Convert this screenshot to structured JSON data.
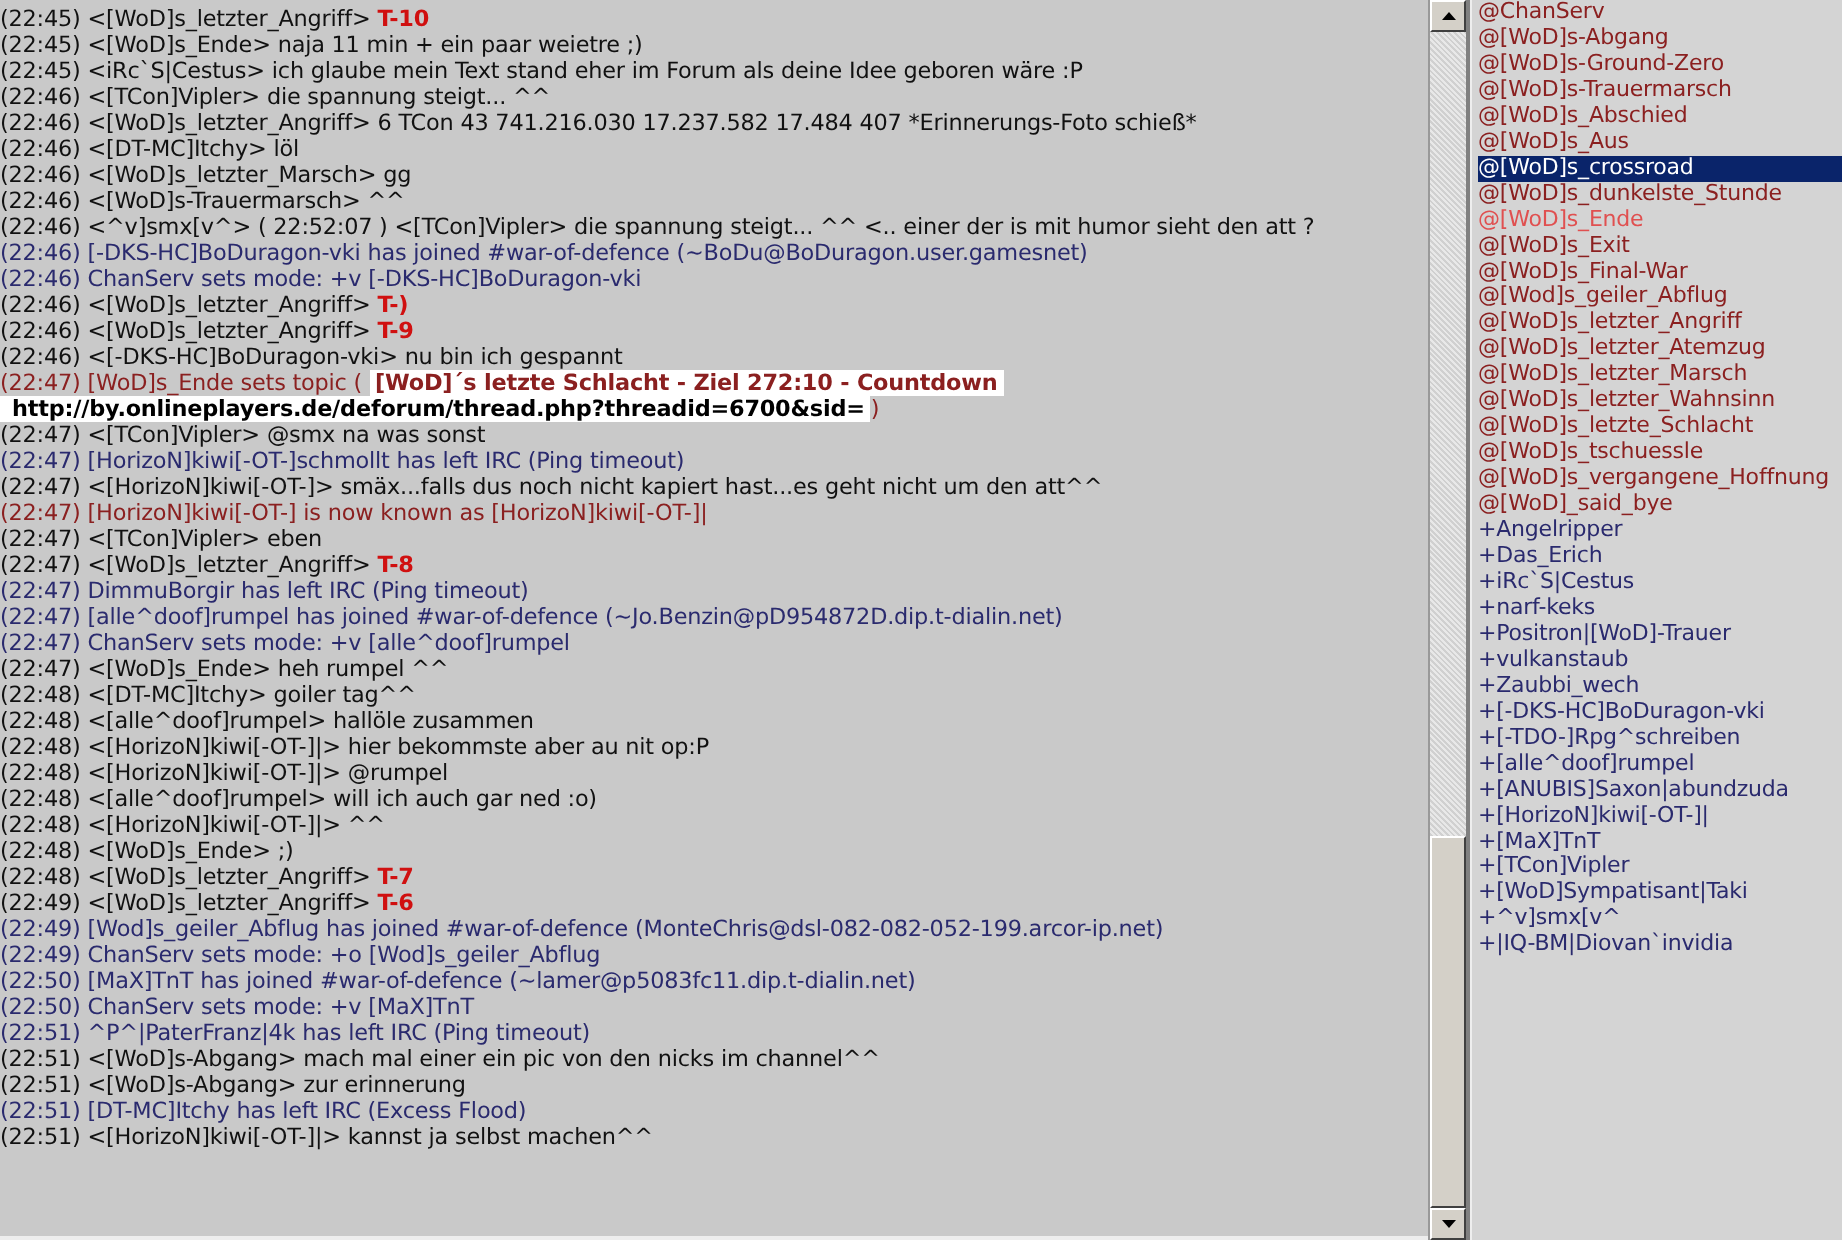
{
  "chat": [
    {
      "time": "(22:45)",
      "kind": "countdown",
      "nick": "<[WoD]s_letzter_Angriff>",
      "text": "T-10"
    },
    {
      "time": "(22:45)",
      "kind": "message",
      "nick": "<[WoD]s_Ende>",
      "text": "naja 11 min + ein paar weietre ;)"
    },
    {
      "time": "(22:45)",
      "kind": "message",
      "nick": "<iRc`S|Cestus>",
      "text": "ich glaube mein Text stand eher im Forum als deine Idee geboren wäre :P"
    },
    {
      "time": "(22:46)",
      "kind": "message",
      "nick": "<[TCon]Vipler>",
      "text": "die spannung steigt... ^^"
    },
    {
      "time": "(22:46)",
      "kind": "message",
      "nick": "<[WoD]s_letzter_Angriff>",
      "text": "6 TCon 43 741.216.030 17.237.582 17.484 407 *Erinnerungs-Foto schieß*"
    },
    {
      "time": "(22:46)",
      "kind": "message",
      "nick": "<[DT-MC]Itchy>",
      "text": "löl"
    },
    {
      "time": "(22:46)",
      "kind": "message",
      "nick": "<[WoD]s_letzter_Marsch>",
      "text": "gg"
    },
    {
      "time": "(22:46)",
      "kind": "message",
      "nick": "<[WoD]s-Trauermarsch>",
      "text": "^^"
    },
    {
      "time": "(22:46)",
      "kind": "message",
      "nick": "<^v]smx[v^>",
      "text": "( 22:52:07 ) <[TCon]Vipler> die spannung steigt... ^^ <.. einer der is mit humor sieht den att ?"
    },
    {
      "time": "(22:46)",
      "kind": "event",
      "text": "[-DKS-HC]BoDuragon-vki has joined #war-of-defence (~BoDu@BoDuragon.user.gamesnet)"
    },
    {
      "time": "(22:46)",
      "kind": "event",
      "text": "ChanServ sets mode: +v [-DKS-HC]BoDuragon-vki"
    },
    {
      "time": "(22:46)",
      "kind": "countdown",
      "nick": "<[WoD]s_letzter_Angriff>",
      "text": "T-)"
    },
    {
      "time": "(22:46)",
      "kind": "countdown",
      "nick": "<[WoD]s_letzter_Angriff>",
      "text": "T-9"
    },
    {
      "time": "(22:46)",
      "kind": "message",
      "nick": "<[-DKS-HC]BoDuragon-vki>",
      "text": "nu bin ich gespannt"
    },
    {
      "time": "(22:47)",
      "kind": "topic",
      "text": "[WoD]s_Ende sets topic (",
      "topic": "[WoD]´s letzte Schlacht - Ziel 272:10 - Countdown",
      "url": "http://by.onlineplayers.de/deforum/thread.php?threadid=6700&sid=",
      "suffix": ")"
    },
    {
      "time": "(22:47)",
      "kind": "message",
      "nick": "<[TCon]Vipler>",
      "text": "@smx na was sonst"
    },
    {
      "time": "(22:47)",
      "kind": "event",
      "text": "[HorizoN]kiwi[-OT-]schmollt has left IRC (Ping timeout)"
    },
    {
      "time": "(22:47)",
      "kind": "message",
      "nick": "<[HorizoN]kiwi[-OT-]>",
      "text": "smäx...falls dus noch nicht kapiert hast...es geht nicht um den att^^"
    },
    {
      "time": "(22:47)",
      "kind": "notice",
      "text": "[HorizoN]kiwi[-OT-] is now known as [HorizoN]kiwi[-OT-]|"
    },
    {
      "time": "(22:47)",
      "kind": "message",
      "nick": "<[TCon]Vipler>",
      "text": "eben"
    },
    {
      "time": "(22:47)",
      "kind": "countdown",
      "nick": "<[WoD]s_letzter_Angriff>",
      "text": "T-8"
    },
    {
      "time": "(22:47)",
      "kind": "event",
      "text": "DimmuBorgir has left IRC (Ping timeout)"
    },
    {
      "time": "(22:47)",
      "kind": "event",
      "text": "[alle^doof]rumpel has joined #war-of-defence (~Jo.Benzin@pD954872D.dip.t-dialin.net)"
    },
    {
      "time": "(22:47)",
      "kind": "event",
      "text": "ChanServ sets mode: +v [alle^doof]rumpel"
    },
    {
      "time": "(22:47)",
      "kind": "message",
      "nick": "<[WoD]s_Ende>",
      "text": "heh rumpel ^^"
    },
    {
      "time": "(22:48)",
      "kind": "message",
      "nick": "<[DT-MC]Itchy>",
      "text": "goiler tag^^"
    },
    {
      "time": "(22:48)",
      "kind": "message",
      "nick": "<[alle^doof]rumpel>",
      "text": "hallöle zusammen"
    },
    {
      "time": "(22:48)",
      "kind": "message",
      "nick": "<[HorizoN]kiwi[-OT-]|>",
      "text": "hier bekommste aber au nit op:P"
    },
    {
      "time": "(22:48)",
      "kind": "message",
      "nick": "<[HorizoN]kiwi[-OT-]|>",
      "text": "@rumpel"
    },
    {
      "time": "(22:48)",
      "kind": "message",
      "nick": "<[alle^doof]rumpel>",
      "text": "will ich auch gar ned :o)"
    },
    {
      "time": "(22:48)",
      "kind": "message",
      "nick": "<[HorizoN]kiwi[-OT-]|>",
      "text": "^^"
    },
    {
      "time": "(22:48)",
      "kind": "message",
      "nick": "<[WoD]s_Ende>",
      "text": ";)"
    },
    {
      "time": "(22:48)",
      "kind": "countdown",
      "nick": "<[WoD]s_letzter_Angriff>",
      "text": "T-7"
    },
    {
      "time": "(22:49)",
      "kind": "countdown",
      "nick": "<[WoD]s_letzter_Angriff>",
      "text": "T-6"
    },
    {
      "time": "(22:49)",
      "kind": "event",
      "text": "[Wod]s_geiler_Abflug has joined #war-of-defence (MonteChris@dsl-082-082-052-199.arcor-ip.net)"
    },
    {
      "time": "(22:49)",
      "kind": "event",
      "text": "ChanServ sets mode: +o [Wod]s_geiler_Abflug"
    },
    {
      "time": "(22:50)",
      "kind": "event",
      "text": "[MaX]TnT has joined #war-of-defence (~lamer@p5083fc11.dip.t-dialin.net)"
    },
    {
      "time": "(22:50)",
      "kind": "event",
      "text": "ChanServ sets mode: +v [MaX]TnT"
    },
    {
      "time": "(22:51)",
      "kind": "event",
      "text": "^P^|PaterFranz|4k has left IRC (Ping timeout)"
    },
    {
      "time": "(22:51)",
      "kind": "message",
      "nick": "<[WoD]s-Abgang>",
      "text": "mach mal einer ein pic von den nicks im channel^^"
    },
    {
      "time": "(22:51)",
      "kind": "message",
      "nick": "<[WoD]s-Abgang>",
      "text": "zur erinnerung"
    },
    {
      "time": "(22:51)",
      "kind": "event",
      "text": "[DT-MC]Itchy has left IRC (Excess Flood)"
    },
    {
      "time": "(22:51)",
      "kind": "message",
      "nick": "<[HorizoN]kiwi[-OT-]|>",
      "text": "kannst ja selbst machen^^"
    }
  ],
  "nicks": [
    {
      "name": "@ChanServ",
      "color": "#8b2020",
      "selected": false
    },
    {
      "name": "@[WoD]s-Abgang",
      "color": "#8b2020",
      "selected": false
    },
    {
      "name": "@[WoD]s-Ground-Zero",
      "color": "#8b2020",
      "selected": false
    },
    {
      "name": "@[WoD]s-Trauermarsch",
      "color": "#8b2020",
      "selected": false
    },
    {
      "name": "@[WoD]s_Abschied",
      "color": "#8b2020",
      "selected": false
    },
    {
      "name": "@[WoD]s_Aus",
      "color": "#8b2020",
      "selected": false
    },
    {
      "name": "@[WoD]s_crossroad",
      "selected": true
    },
    {
      "name": "@[WoD]s_dunkelste_Stunde",
      "color": "#8b2020",
      "selected": false
    },
    {
      "name": "@[WoD]s_Ende",
      "color": "#e05050",
      "selected": false
    },
    {
      "name": "@[WoD]s_Exit",
      "color": "#8b2020",
      "selected": false
    },
    {
      "name": "@[WoD]s_Final-War",
      "color": "#8b2020",
      "selected": false
    },
    {
      "name": "@[Wod]s_geiler_Abflug",
      "color": "#8b2020",
      "selected": false
    },
    {
      "name": "@[WoD]s_letzter_Angriff",
      "color": "#8b2020",
      "selected": false
    },
    {
      "name": "@[WoD]s_letzter_Atemzug",
      "color": "#8b2020",
      "selected": false
    },
    {
      "name": "@[WoD]s_letzter_Marsch",
      "color": "#8b2020",
      "selected": false
    },
    {
      "name": "@[WoD]s_letzter_Wahnsinn",
      "color": "#8b2020",
      "selected": false
    },
    {
      "name": "@[WoD]s_letzte_Schlacht",
      "color": "#8b2020",
      "selected": false
    },
    {
      "name": "@[WoD]s_tschuessle",
      "color": "#8b2020",
      "selected": false
    },
    {
      "name": "@[WoD]s_vergangene_Hoffnung",
      "color": "#8b2020",
      "selected": false
    },
    {
      "name": "@[WoD]_said_bye",
      "color": "#8b2020",
      "selected": false
    },
    {
      "name": "+Angelripper",
      "color": "#2a2a6e",
      "selected": false
    },
    {
      "name": "+Das_Erich",
      "color": "#2a2a6e",
      "selected": false
    },
    {
      "name": "+iRc`S|Cestus",
      "color": "#2a2a6e",
      "selected": false
    },
    {
      "name": "+narf-keks",
      "color": "#2a2a6e",
      "selected": false
    },
    {
      "name": "+Positron|[WoD]-Trauer",
      "color": "#2a2a6e",
      "selected": false
    },
    {
      "name": "+vulkanstaub",
      "color": "#2a2a6e",
      "selected": false
    },
    {
      "name": "+Zaubbi_wech",
      "color": "#2a2a6e",
      "selected": false
    },
    {
      "name": "+[-DKS-HC]BoDuragon-vki",
      "color": "#2a2a6e",
      "selected": false
    },
    {
      "name": "+[-TDO-]Rpg^schreiben",
      "color": "#2a2a6e",
      "selected": false
    },
    {
      "name": "+[alle^doof]rumpel",
      "color": "#2a2a6e",
      "selected": false
    },
    {
      "name": "+[ANUBIS]Saxon|abundzuda",
      "color": "#2a2a6e",
      "selected": false
    },
    {
      "name": "+[HorizoN]kiwi[-OT-]|",
      "color": "#2a2a6e",
      "selected": false
    },
    {
      "name": "+[MaX]TnT",
      "color": "#2a2a6e",
      "selected": false
    },
    {
      "name": "+[TCon]Vipler",
      "color": "#2a2a6e",
      "selected": false
    },
    {
      "name": "+[WoD]Sympatisant|Taki",
      "color": "#2a2a6e",
      "selected": false
    },
    {
      "name": "+^v]smx[v^",
      "color": "#2a2a6e",
      "selected": false
    },
    {
      "name": "+|IQ-BM|Diovan`invidia",
      "color": "#2a2a6e",
      "selected": false
    }
  ]
}
